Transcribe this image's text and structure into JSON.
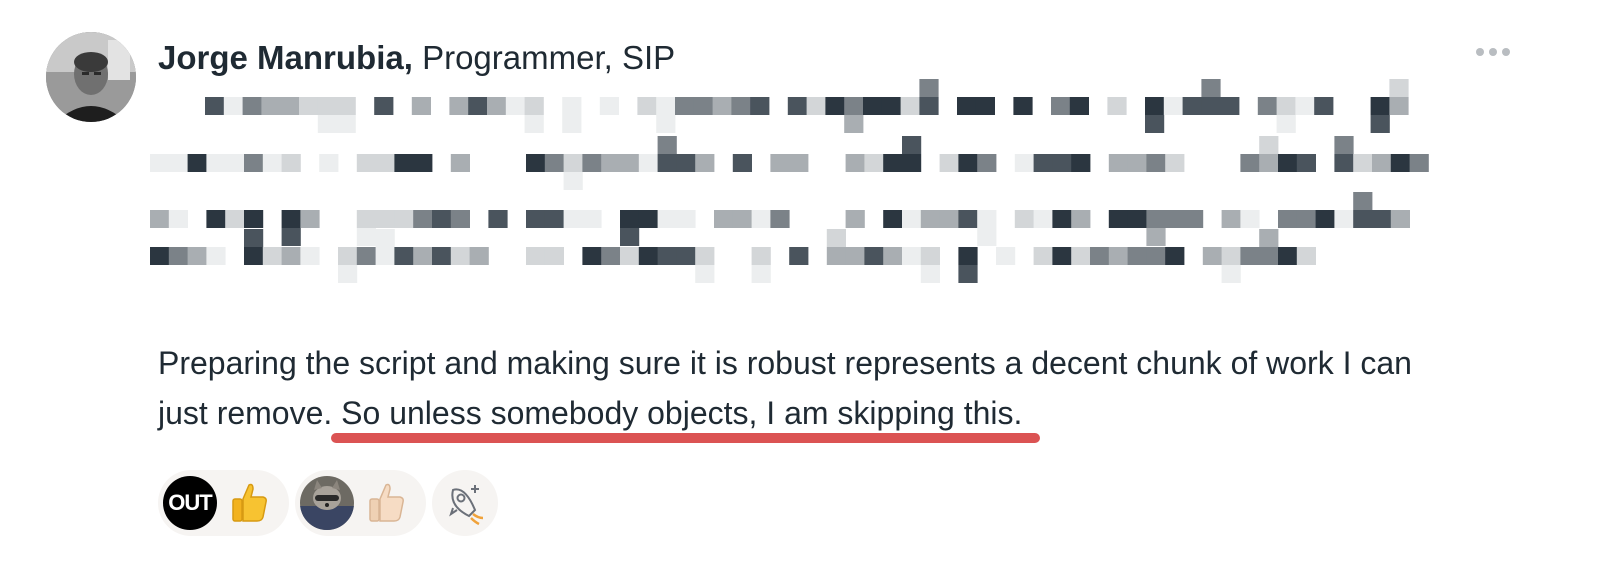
{
  "post": {
    "author": {
      "name": "Jorge Manrubia,",
      "title": "Programmer, SIP",
      "avatar_icon": "person-photo"
    },
    "redacted_text_note": "",
    "body_prefix": "Preparing the script and making sure it is robust represents a decent chunk of work I can just remove. ",
    "body_highlight": "So unless somebody objects, I am skipping this.",
    "highlight_color": "#db5353",
    "more_icon": "ellipsis-icon"
  },
  "boosts": [
    {
      "avatar_label": "OUT",
      "emoji_icon": "thumbs-up-yellow-icon"
    },
    {
      "avatar_icon": "raccoon-photo",
      "emoji_icon": "thumbs-up-light-icon"
    }
  ],
  "add_boost_icon": "rocket-plus-icon",
  "colors": {
    "text": "#1f2a33",
    "pill_background": "#f6f4f2",
    "muted": "#b9bdc1"
  }
}
